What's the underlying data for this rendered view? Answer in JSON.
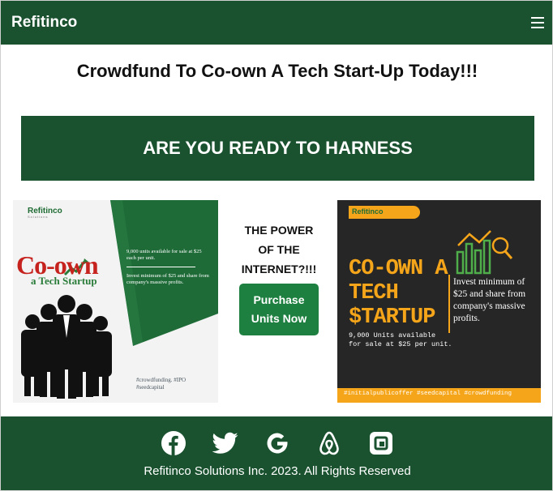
{
  "navbar": {
    "brand": "Refitinco",
    "menu_icon": "hamburger-icon"
  },
  "main": {
    "headline": "Crowdfund To Co-own A Tech Start-Up Today!!!",
    "banner_text": "ARE YOU READY TO HARNESS",
    "mid_text_lines": [
      "THE POWER",
      "OF THE",
      "INTERNET?!!!"
    ],
    "purchase_button": [
      "Purchase",
      "Units Now"
    ]
  },
  "promo_left": {
    "logo": "Refitinco",
    "logo_sub": "Solutions",
    "headline": "Co-own",
    "subheadline": "a Tech Startup",
    "text1": "9,000 units available for sale at $25 each per unit.",
    "text2": "Invest minimum of $25 and share from company's massive profits.",
    "tags": "#crowdfunding. #IPO #seedcapital"
  },
  "promo_right": {
    "logo": "Refitinco",
    "title_lines": [
      "CO-OWN A",
      "TECH",
      "$TARTUP"
    ],
    "units_lines": [
      "9,000 Units available",
      "for sale at $25 per unit."
    ],
    "invest": "Invest minimum of $25 and share from company's massive profits.",
    "tags": "#initialpublicoffer #seedcapital #crowdfunding"
  },
  "footer": {
    "social_icons": [
      "facebook-icon",
      "twitter-icon",
      "google-icon",
      "airbnb-icon",
      "dropbox-icon"
    ],
    "copyright": "Refitinco Solutions Inc. 2023. All Rights Reserved"
  },
  "colors": {
    "brand_green": "#1a5230",
    "button_green": "#1e8040",
    "accent_orange": "#f5a51a"
  }
}
